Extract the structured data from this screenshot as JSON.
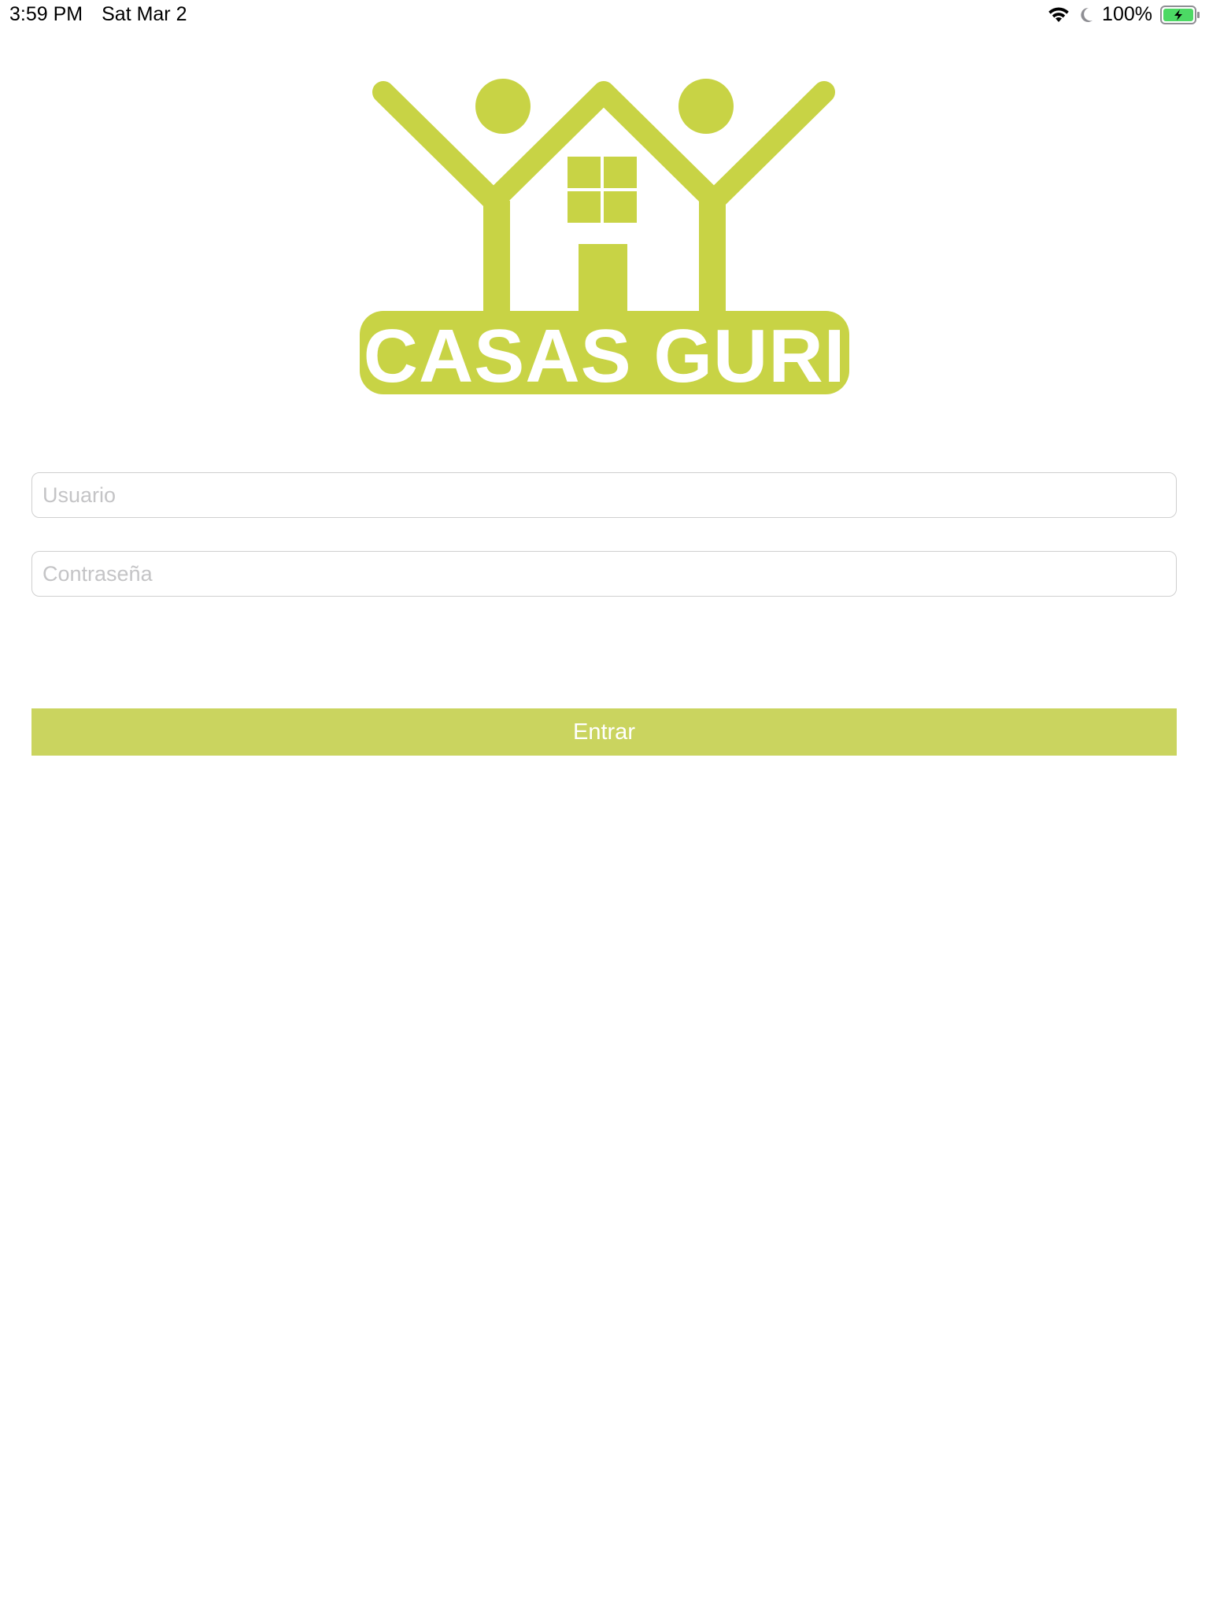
{
  "status_bar": {
    "time": "3:59 PM",
    "date": "Sat Mar 2",
    "battery_percent": "100%",
    "battery_level": 1.0,
    "icons": [
      "wifi-icon",
      "moon-icon",
      "battery-charging-icon"
    ]
  },
  "logo": {
    "text": "CASAS GURI",
    "color": "#c8d345"
  },
  "form": {
    "username_placeholder": "Usuario",
    "username_value": "",
    "password_placeholder": "Contraseña",
    "password_value": "",
    "submit_label": "Entrar",
    "button_color": "#cad45f"
  }
}
